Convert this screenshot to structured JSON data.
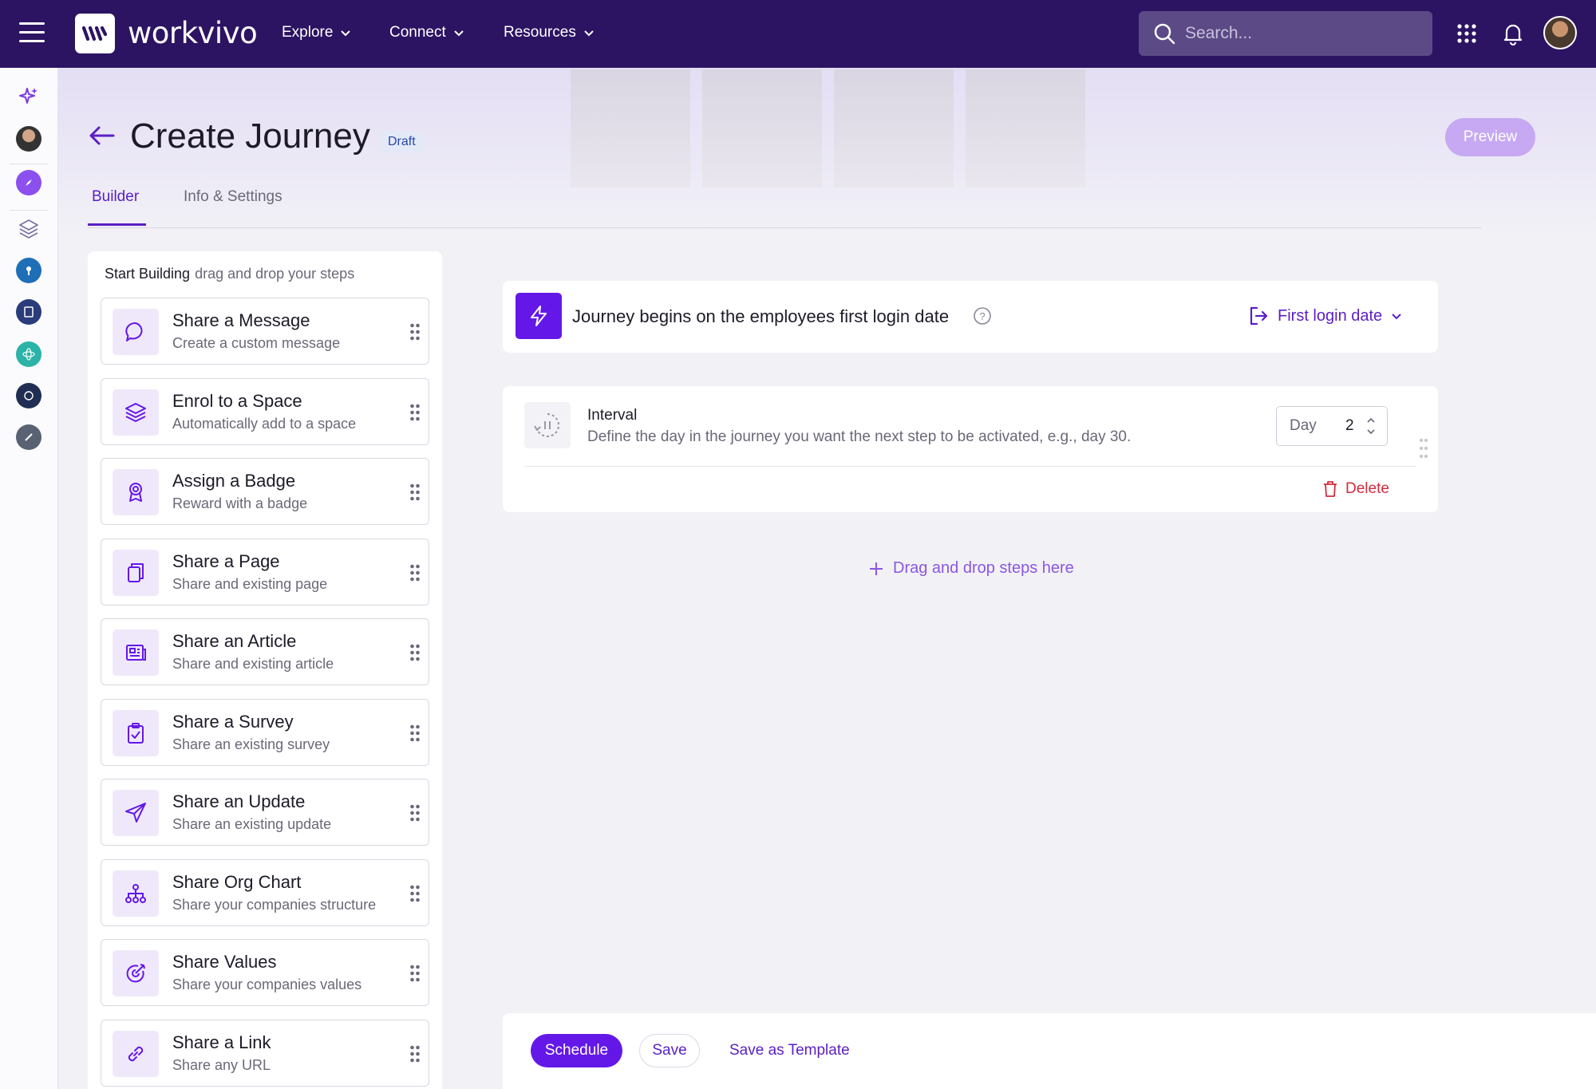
{
  "app": {
    "brand": "workvivo",
    "nav": [
      {
        "label": "Explore"
      },
      {
        "label": "Connect"
      },
      {
        "label": "Resources"
      }
    ],
    "search_placeholder": "Search..."
  },
  "page": {
    "title": "Create Journey",
    "status_badge": "Draft",
    "preview_label": "Preview",
    "tabs": [
      {
        "label": "Builder",
        "active": true
      },
      {
        "label": "Info & Settings",
        "active": false
      }
    ]
  },
  "builder_panel": {
    "heading": "Start Building",
    "hint": "drag and drop your steps",
    "steps": [
      {
        "title": "Share a Message",
        "subtitle": "Create a custom message",
        "icon": "chat-bubble-icon"
      },
      {
        "title": "Enrol to a Space",
        "subtitle": "Automatically add to a space",
        "icon": "layers-icon"
      },
      {
        "title": "Assign a Badge",
        "subtitle": "Reward with a badge",
        "icon": "badge-icon"
      },
      {
        "title": "Share a Page",
        "subtitle": "Share and existing page",
        "icon": "pages-icon"
      },
      {
        "title": "Share an Article",
        "subtitle": "Share and existing article",
        "icon": "newspaper-icon"
      },
      {
        "title": "Share a Survey",
        "subtitle": "Share an existing survey",
        "icon": "clipboard-check-icon"
      },
      {
        "title": "Share an Update",
        "subtitle": "Share an existing update",
        "icon": "paper-plane-icon"
      },
      {
        "title": "Share Org Chart",
        "subtitle": "Share your companies structure",
        "icon": "org-chart-icon"
      },
      {
        "title": "Share Values",
        "subtitle": "Share your companies values",
        "icon": "target-icon"
      },
      {
        "title": "Share a Link",
        "subtitle": "Share any URL",
        "icon": "link-icon"
      }
    ]
  },
  "trigger": {
    "text": "Journey begins on the employees first login date",
    "select_value": "First login date",
    "icon": "lightning-icon"
  },
  "interval": {
    "title": "Interval",
    "description": "Define the day in the journey you want the next step to be activated, e.g., day 30.",
    "unit_label": "Day",
    "value": "2",
    "delete_label": "Delete"
  },
  "dropzone": {
    "label": "Drag and drop steps here"
  },
  "footer": {
    "schedule_label": "Schedule",
    "save_label": "Save",
    "template_label": "Save as Template"
  },
  "colors": {
    "topbar": "#2c1463",
    "accent": "#6418e8",
    "accent_text": "#5a1fc4",
    "danger": "#d12c3c"
  }
}
